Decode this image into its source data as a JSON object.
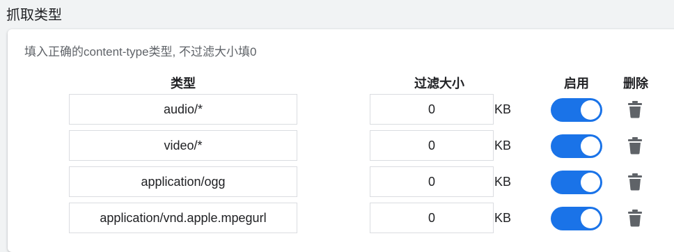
{
  "section": {
    "title": "抓取类型"
  },
  "card": {
    "hint": "填入正确的content-type类型, 不过滤大小填0",
    "headers": {
      "type": "类型",
      "size": "过滤大小",
      "enabled": "启用",
      "delete": "删除"
    },
    "rows": [
      {
        "type": "audio/*",
        "size": "0",
        "unit": "KB",
        "enabled": true
      },
      {
        "type": "video/*",
        "size": "0",
        "unit": "KB",
        "enabled": true
      },
      {
        "type": "application/ogg",
        "size": "0",
        "unit": "KB",
        "enabled": true
      },
      {
        "type": "application/vnd.apple.mpegurl",
        "size": "0",
        "unit": "KB",
        "enabled": true
      }
    ]
  },
  "colors": {
    "accent": "#1a73e8",
    "icon": "#5f6368",
    "border": "#dadce0"
  }
}
